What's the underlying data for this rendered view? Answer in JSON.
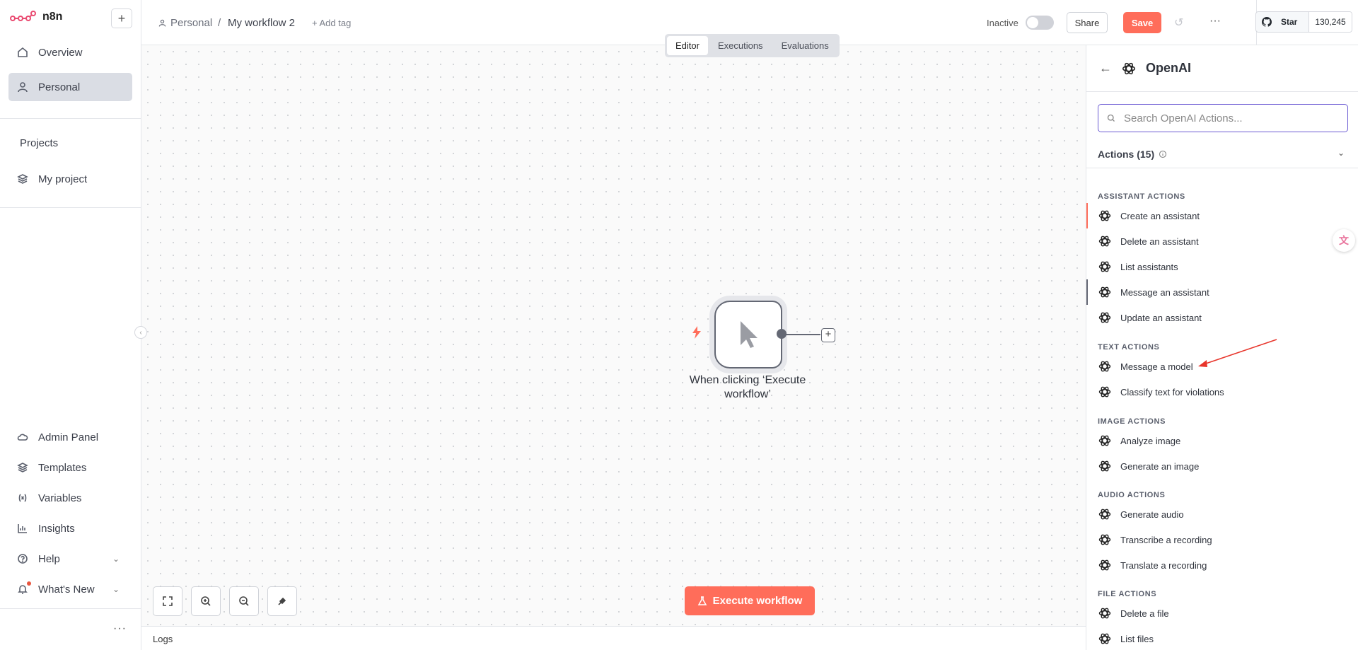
{
  "app": {
    "name": "n8n"
  },
  "sidebar": {
    "add_label": "+",
    "top_items": [
      {
        "label": "Overview",
        "icon": "home-icon"
      },
      {
        "label": "Personal",
        "icon": "user-icon",
        "active": true
      }
    ],
    "projects_title": "Projects",
    "projects": [
      {
        "label": "My project",
        "icon": "layers-icon"
      }
    ],
    "bottom_items": [
      {
        "label": "Admin Panel",
        "icon": "cloud-icon"
      },
      {
        "label": "Templates",
        "icon": "templates-icon"
      },
      {
        "label": "Variables",
        "icon": "variables-icon"
      },
      {
        "label": "Insights",
        "icon": "chart-icon"
      },
      {
        "label": "Help",
        "icon": "help-icon",
        "caret": true
      },
      {
        "label": "What's New",
        "icon": "bell-icon",
        "caret": true
      }
    ],
    "more_label": "···"
  },
  "header": {
    "breadcrumb_project": "Personal",
    "separator": "/",
    "workflow_name": "My workflow 2",
    "add_tag": "+ Add tag",
    "status_label": "Inactive",
    "share_label": "Share",
    "save_label": "Save",
    "more_label": "···",
    "github": {
      "star_label": "Star",
      "count": "130,245"
    }
  },
  "canvas": {
    "tabs": [
      {
        "label": "Editor",
        "active": true
      },
      {
        "label": "Executions"
      },
      {
        "label": "Evaluations"
      }
    ],
    "node": {
      "label": "When clicking ‘Execute workflow’"
    },
    "execute_label": "Execute workflow",
    "logs_label": "Logs"
  },
  "panel": {
    "title": "OpenAI",
    "search_placeholder": "Search OpenAI Actions...",
    "actions_header": "Actions (15)",
    "categories": [
      {
        "title": "ASSISTANT ACTIONS",
        "items": [
          "Create an assistant",
          "Delete an assistant",
          "List assistants",
          "Message an assistant",
          "Update an assistant"
        ]
      },
      {
        "title": "TEXT ACTIONS",
        "items": [
          "Message a model",
          "Classify text for violations"
        ]
      },
      {
        "title": "IMAGE ACTIONS",
        "items": [
          "Analyze image",
          "Generate an image"
        ]
      },
      {
        "title": "AUDIO ACTIONS",
        "items": [
          "Generate audio",
          "Transcribe a recording",
          "Translate a recording"
        ]
      },
      {
        "title": "FILE ACTIONS",
        "items": [
          "Delete a file",
          "List files"
        ]
      }
    ]
  },
  "colors": {
    "accent": "#ff6d5a",
    "focus": "#6b5bd3",
    "annotation_arrow": "#e8352b"
  }
}
